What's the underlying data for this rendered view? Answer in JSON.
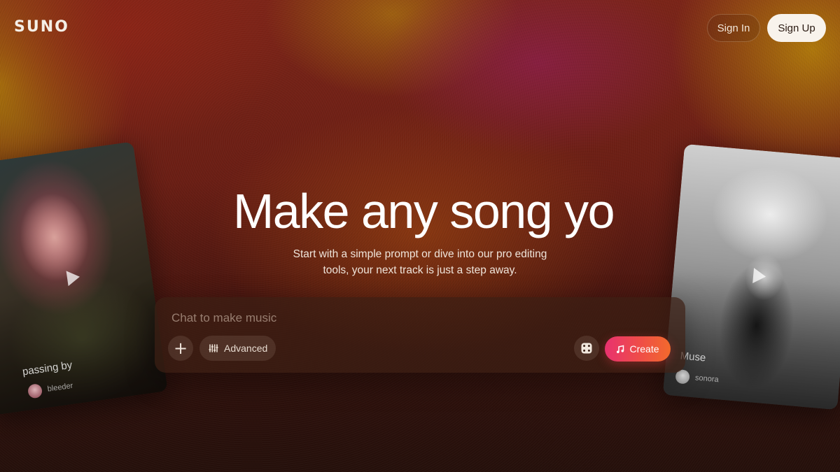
{
  "brand": {
    "logo_text": "SUNO"
  },
  "header": {
    "sign_in_label": "Sign In",
    "sign_up_label": "Sign Up"
  },
  "hero": {
    "headline": "Make any song yo",
    "subtitle_line1": "Start with a simple prompt or dive into our pro editing",
    "subtitle_line2": "tools, your next track is just a step away."
  },
  "composer": {
    "placeholder": "Chat to make music",
    "plus_icon": "plus-icon",
    "advanced_label": "Advanced",
    "advanced_icon": "sliders-icon",
    "dice_icon": "dice-icon",
    "create_label": "Create",
    "create_icon": "music-note-icon",
    "create_gradient": [
      "#e8326f",
      "#f26a2c"
    ]
  },
  "showcase": {
    "left_card": {
      "title": "passing by",
      "user": "bleeder",
      "icon": "play-icon"
    },
    "right_card": {
      "title": "Muse",
      "user": "sonora",
      "icon": "play-icon"
    }
  },
  "colors": {
    "signup_bg": "#f8f3ec",
    "text_primary": "#ffffff"
  }
}
